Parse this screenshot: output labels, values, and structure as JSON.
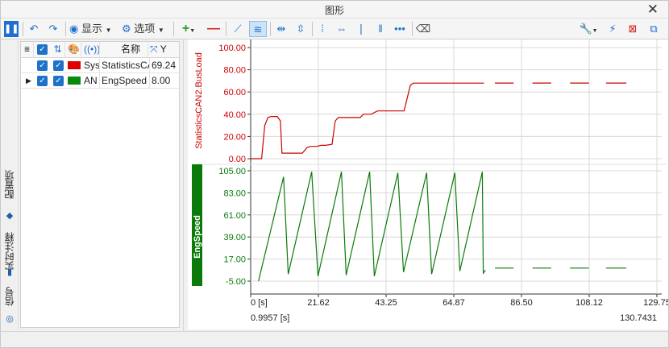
{
  "window": {
    "title": "图形"
  },
  "toolbar": {
    "display_label": "显示",
    "options_label": "选项"
  },
  "left_tabs": {
    "config": "配置项",
    "annotation": "实时注释",
    "signal": "信号"
  },
  "grid": {
    "headers": {
      "name": "名称",
      "y": "Y"
    },
    "rows": [
      {
        "short": "Sys",
        "name": "StatisticsCAN2.BusLoad",
        "value": "69.24",
        "color": "#e00000"
      },
      {
        "short": "AN",
        "name": "EngSpeed",
        "value": "8.00",
        "color": "#0a8a0a"
      }
    ]
  },
  "chart_data": [
    {
      "type": "line",
      "ylabel": "StatisticsCAN2.BusLoad",
      "ylim": [
        0,
        100
      ],
      "y_ticks": [
        "100.00",
        "80.00",
        "60.00",
        "40.00",
        "20.00",
        "0.00"
      ],
      "color": "#cc0000",
      "series": [
        {
          "x": [
            0,
            3.5,
            4.0,
            4.5,
            5.5,
            6.5,
            8.5,
            9.5,
            10.0,
            11.5,
            12.8,
            14.5,
            16.5,
            18.0,
            19.0,
            20.0,
            21.0,
            22.5,
            24.0,
            26.0,
            27.0,
            28.0,
            29.5,
            31.0,
            33.5,
            35.0,
            36.0,
            38.5,
            40.5,
            43.0,
            46.5,
            49.0,
            51.0,
            52.0,
            55.0,
            60.0,
            65.0,
            70.0,
            74.5
          ],
          "values": [
            0,
            0,
            15,
            30,
            37,
            38,
            38,
            34,
            5,
            5,
            5,
            5,
            5,
            10,
            11,
            11,
            11,
            12,
            12,
            13,
            34,
            37,
            37,
            37,
            37,
            37,
            40,
            40,
            43,
            43,
            43,
            43,
            66,
            68,
            68,
            68,
            68,
            68,
            68
          ]
        },
        {
          "segments": [
            [
              78,
              84
            ],
            [
              90,
              96
            ],
            [
              102,
              108
            ],
            [
              113.5,
              120
            ]
          ],
          "value": 68
        }
      ]
    },
    {
      "type": "line",
      "ylabel": "EngSpeed",
      "ylim": [
        -5,
        105
      ],
      "y_ticks": [
        "105.00",
        "83.00",
        "61.00",
        "39.00",
        "17.00",
        "-5.00"
      ],
      "color": "#0a7a0a",
      "series": [
        {
          "x": [
            2.5,
            10.5,
            12.0,
            19.5,
            21.5,
            29.0,
            30.5,
            38.0,
            39.5,
            47.0,
            48.8,
            56.2,
            57.8,
            65.2,
            66.8,
            74.0,
            74.3,
            75.0
          ],
          "values": [
            -5,
            99,
            2,
            104,
            0,
            104,
            1,
            104,
            0,
            103,
            4,
            103,
            2,
            103,
            5,
            104,
            3,
            6
          ]
        },
        {
          "segments": [
            [
              78,
              84
            ],
            [
              90,
              96
            ],
            [
              102,
              108
            ],
            [
              113.5,
              120
            ]
          ],
          "value": 8
        }
      ]
    }
  ],
  "x_axis": {
    "ticks": [
      "0 [s]",
      "21.62",
      "43.25",
      "64.87",
      "86.50",
      "108.12",
      "129.75"
    ],
    "xlim": [
      0,
      129.75
    ],
    "cursor_left": "0.9957 [s]",
    "cursor_right": "130.7431"
  }
}
